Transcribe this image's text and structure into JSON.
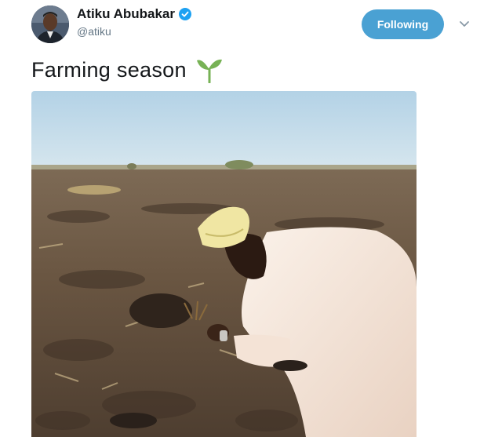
{
  "author": {
    "display_name": "Atiku Abubakar",
    "handle": "@atiku",
    "verified": true,
    "verified_icon": "verified-badge-icon"
  },
  "follow_button": {
    "label": "Following"
  },
  "menu_icon": "chevron-down-icon",
  "tweet": {
    "text": "Farming season",
    "emoji_icon": "seedling-icon"
  },
  "colors": {
    "follow_bg": "#4aa1d3",
    "verified_blue": "#1da1f2",
    "handle_gray": "#657786",
    "seedling_green": "#77b255"
  }
}
